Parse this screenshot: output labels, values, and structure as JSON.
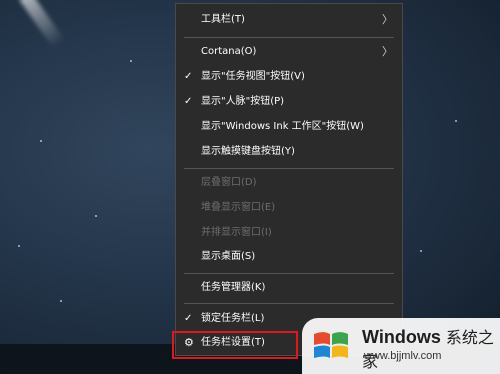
{
  "menu": {
    "items": [
      {
        "label": "工具栏(T)",
        "has_submenu": true
      },
      {
        "label": "Cortana(O)",
        "has_submenu": true
      },
      {
        "label": "显示\"任务视图\"按钮(V)",
        "checked": true
      },
      {
        "label": "显示\"人脉\"按钮(P)",
        "checked": true
      },
      {
        "label": "显示\"Windows Ink 工作区\"按钮(W)"
      },
      {
        "label": "显示触摸键盘按钮(Y)"
      },
      {
        "label": "层叠窗口(D)",
        "disabled": true
      },
      {
        "label": "堆叠显示窗口(E)",
        "disabled": true
      },
      {
        "label": "并排显示窗口(I)",
        "disabled": true
      },
      {
        "label": "显示桌面(S)"
      },
      {
        "label": "任务管理器(K)"
      },
      {
        "label": "锁定任务栏(L)",
        "checked": true
      },
      {
        "label": "任务栏设置(T)",
        "icon": "gear-icon",
        "highlighted": true
      }
    ],
    "check_glyph": "✓",
    "arrow_glyph": "〉",
    "gear_glyph": "⚙"
  },
  "watermark": {
    "brand": "Windows",
    "brand_cn": "系统之家",
    "url": "www.bjjmlv.com"
  },
  "colors": {
    "menu_bg": "#2b2b2b",
    "highlight_border": "#e0181d",
    "disabled_text": "#6d6d6d"
  }
}
